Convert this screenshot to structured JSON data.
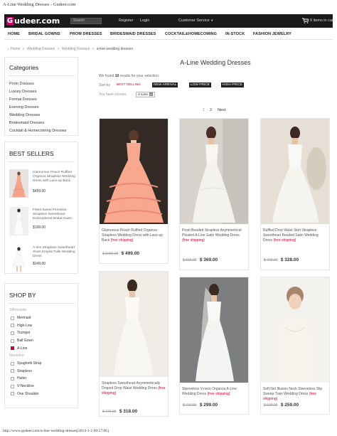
{
  "print_header": "A-Line Wedding Dresses - Gudeer.com",
  "print_footer": "http://www.gudeer.com/a-line-wedding-dresses[2014-1-2 09:57:06]",
  "brand": {
    "logo_initial": "G",
    "logo_rest": "udeer.com",
    "accent": "#cc0066"
  },
  "topbar": {
    "search_placeholder": "Search",
    "register": "Register",
    "login": "Login",
    "customer_service": "Customer Service",
    "cart_text": "0 items in cart"
  },
  "nav": [
    "HOME",
    "BRIDAL GOWNS",
    "PROM DRESSES",
    "BRIDESMAID DRESSES",
    "COCKTAIL&HOMECOMING",
    "IN-STOCK",
    "FASHION JEWELRY"
  ],
  "breadcrumb": [
    "Home",
    "Wedding Dresses",
    "Wedding Dresses",
    "a-line wedding dresses"
  ],
  "categories": {
    "title": "Categories",
    "items": [
      "Prom Dresses",
      "Luxury Dresses",
      "Formal Dresses",
      "Evening Dresses",
      "Wedding Dresses",
      "Bridesmaid Dresses",
      "Cocktail & Homecoming Dresses"
    ]
  },
  "bestsellers": {
    "title": "BEST SELLERS",
    "items": [
      {
        "name": "Glamorous Peach Ruffled Organza Strapless Wedding Dress with Lace-up Back",
        "price": "$499.00"
      },
      {
        "name": "Fitted Sweet Feminine Strapless Sweetheart Embroidered Bridal Gown",
        "price": "$199.00"
      },
      {
        "name": "A-line Strapless Sweetheart Short Empire Tulle Wedding Dress",
        "price": "$149.00"
      }
    ]
  },
  "shopby": {
    "title": "SHOP BY",
    "silhouette_label": "Silhouette",
    "silhouette": [
      {
        "label": "Mermaid",
        "checked": false
      },
      {
        "label": "High-Low",
        "checked": false
      },
      {
        "label": "Trumpet",
        "checked": false
      },
      {
        "label": "Ball Gown",
        "checked": false
      },
      {
        "label": "A-Line",
        "checked": true
      }
    ],
    "neckline_label": "Neckline",
    "neckline": [
      {
        "label": "Spaghetti Strap",
        "checked": false
      },
      {
        "label": "Strapless",
        "checked": false
      },
      {
        "label": "Halter",
        "checked": false
      },
      {
        "label": "V-Neckline",
        "checked": false
      },
      {
        "label": "One Shoulder",
        "checked": false
      }
    ]
  },
  "main": {
    "title": "A-Line Wedding Dresses",
    "found_prefix": "We found",
    "found_count": "10",
    "found_suffix": "results for your selection.",
    "sort_label": "Sort by",
    "sort_options": [
      "BEST SELLING",
      "NEW ARRIVAL",
      "LOW PRICE",
      "HIGH PRICE"
    ],
    "chosen_label": "You have chosen:",
    "chosen_tag": "A-Line",
    "chosen_remove": "x",
    "pages": [
      "1",
      "2",
      "Next"
    ]
  },
  "products": [
    {
      "name": "Glamorous Peach Ruffled Organza Strapless Wedding Dress with Lace-up Back",
      "ship": "(free shipping)",
      "old_price": "$ 1000.00",
      "price": "$ 499.00"
    },
    {
      "name": "Pearl Beaded Strapless Asymmetrical Pleated A-Line Satin Wedding Dress",
      "ship": "(free shipping)",
      "old_price": "$ 669.00",
      "price": "$ 369.00"
    },
    {
      "name": "Ruffled Drop Waist Skirt Strapless Sweetheart Beaded Satin Wedding Dress",
      "ship": "(free shipping)",
      "old_price": "$ 709.00",
      "price": "$ 328.00"
    },
    {
      "name": "Strapless Sweetheart Asymmetrically Draped Drop Waist Wedding Dress",
      "ship": "(free shipping)",
      "old_price": "$ 779.00",
      "price": "$ 318.00"
    },
    {
      "name": "Sleeveless V-neck Organza A-Line Wedding Dress",
      "ship": "(free shipping)",
      "old_price": "$ 719.00",
      "price": "$ 299.00"
    },
    {
      "name": "Soft Net Illusion Neck Sleeveless Slip Sweep Train Wedding Dress",
      "ship": "(free shipping)",
      "old_price": "$ 639.00",
      "price": "$ 259.00"
    }
  ]
}
